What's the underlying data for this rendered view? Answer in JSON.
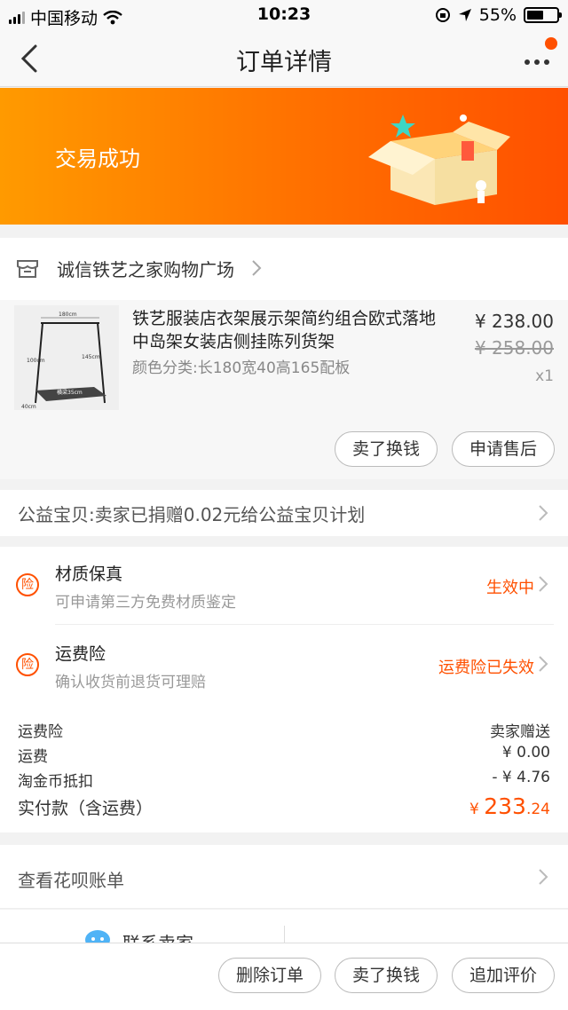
{
  "status_bar": {
    "carrier": "中国移动",
    "time": "10:23",
    "battery": "55%",
    "battery_level": 0.55
  },
  "nav": {
    "title": "订单详情"
  },
  "banner": {
    "status": "交易成功"
  },
  "shop": {
    "name": "诚信铁艺之家购物广场"
  },
  "product": {
    "title": "铁艺服装店衣架展示架简约组合欧式落地中岛架女装店侧挂陈列货架",
    "spec": "颜色分类:长180宽40高165配板",
    "price": "¥ 238.00",
    "original_price": "¥ 258.00",
    "quantity": "x1",
    "buttons": [
      "卖了换钱",
      "申请售后"
    ],
    "thumb_labels": [
      "180cm",
      "145cm",
      "100cm",
      "40cm",
      "横梁35cm"
    ]
  },
  "charity": {
    "text": "公益宝贝:卖家已捐赠0.02元给公益宝贝计划"
  },
  "insurance": [
    {
      "badge": "险",
      "title": "材质保真",
      "desc": "可申请第三方免费材质鉴定",
      "status": "生效中"
    },
    {
      "badge": "险",
      "title": "运费险",
      "desc": "确认收货前退货可理赔",
      "status": "运费险已失效"
    }
  ],
  "fees": [
    {
      "label": "运费险",
      "value": "卖家赠送"
    },
    {
      "label": "运费",
      "value": "¥ 0.00"
    },
    {
      "label": "淘金币抵扣",
      "value": "- ¥ 4.76"
    }
  ],
  "total": {
    "label": "实付款（含运费）",
    "currency": "¥ ",
    "integer": "233",
    "decimal": ".24"
  },
  "huabei": {
    "text": "查看花呗账单"
  },
  "contact": {
    "label": "联系卖家"
  },
  "bottom_actions": [
    "删除订单",
    "卖了换钱",
    "追加评价"
  ],
  "colors": {
    "accent": "#ff5000",
    "banner_start": "#ff9a00",
    "banner_end": "#ff5000"
  }
}
